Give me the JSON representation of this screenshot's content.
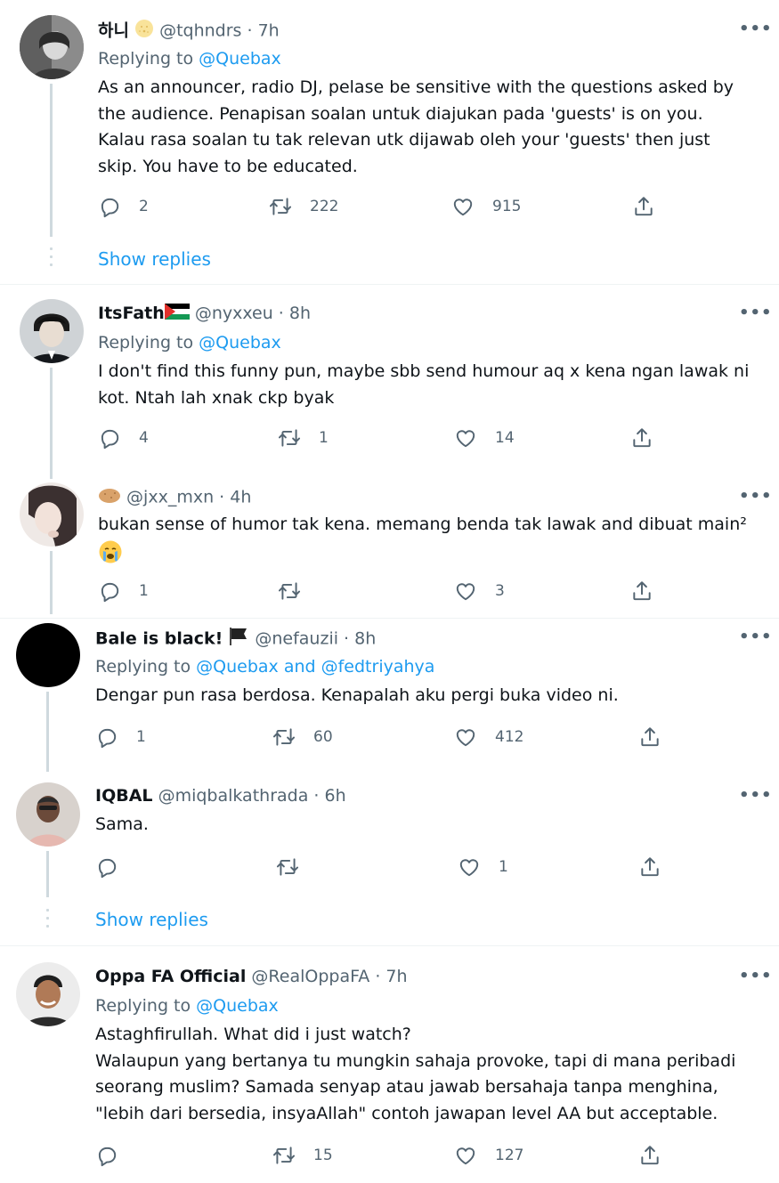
{
  "tweets": [
    {
      "name": "하니",
      "handle": "@tqhndrs",
      "time": "· 7h",
      "replying_prefix": "Replying to ",
      "replying_to": "@Quebax",
      "text": "As an announcer, radio DJ, pelase be sensitive with the questions asked by\nthe audience. Penapisan soalan untuk diajukan pada 'guests' is on you.\nKalau rasa soalan tu tak relevan utk dijawab oleh your 'guests' then just\nskip. You have to be educated.",
      "replies": "2",
      "retweets": "222",
      "likes": "915"
    },
    {
      "name": "ItsFath",
      "handle": "@nyxxeu",
      "time": "· 8h",
      "replying_prefix": "Replying to ",
      "replying_to": "@Quebax",
      "text": "I don't find this funny pun, maybe sbb send humour aq x kena ngan lawak ni\nkot. Ntah lah xnak ckp byak",
      "replies": "4",
      "retweets": "1",
      "likes": "14"
    },
    {
      "name": "",
      "handle": "@jxx_mxn",
      "time": "· 4h",
      "text": "bukan sense of humor tak kena. memang benda tak lawak and dibuat main²",
      "replies": "1",
      "retweets": "",
      "likes": "3"
    },
    {
      "name": "Bale is black!",
      "handle": "@nefauzii",
      "time": "· 8h",
      "replying_prefix": "Replying to ",
      "replying_to": "@Quebax and @fedtriyahya",
      "text": "Dengar pun rasa berdosa. Kenapalah aku pergi buka video ni.",
      "replies": "1",
      "retweets": "60",
      "likes": "412"
    },
    {
      "name": "IQBAL",
      "handle": "@miqbalkathrada",
      "time": "· 6h",
      "text": "Sama.",
      "replies": "",
      "retweets": "",
      "likes": "1"
    },
    {
      "name": "Oppa FA Official",
      "handle": "@RealOppaFA",
      "time": "· 7h",
      "replying_prefix": "Replying to ",
      "replying_to": "@Quebax",
      "text": "Astaghfirullah. What did i just watch?\nWalaupun yang bertanya tu mungkin sahaja provoke, tapi di mana peribadi\nseorang muslim? Samada senyap atau jawab bersahaja tanpa menghina,\n\"lebih dari bersedia, insyaAllah\" contoh jawapan level AA but acceptable.",
      "replies": "",
      "retweets": "15",
      "likes": "127"
    }
  ],
  "show_replies_label": "Show replies",
  "more_label": "•••",
  "colors": {
    "link": "#1d9bf0",
    "muted": "#536471",
    "text": "#0f1419",
    "thread": "#cfd9de"
  },
  "icons": [
    "reply-icon",
    "retweet-icon",
    "like-icon",
    "share-icon",
    "more-icon",
    "palestine-flag-icon",
    "black-flag-icon",
    "crying-face-icon",
    "potato-icon",
    "sun-face-icon"
  ]
}
